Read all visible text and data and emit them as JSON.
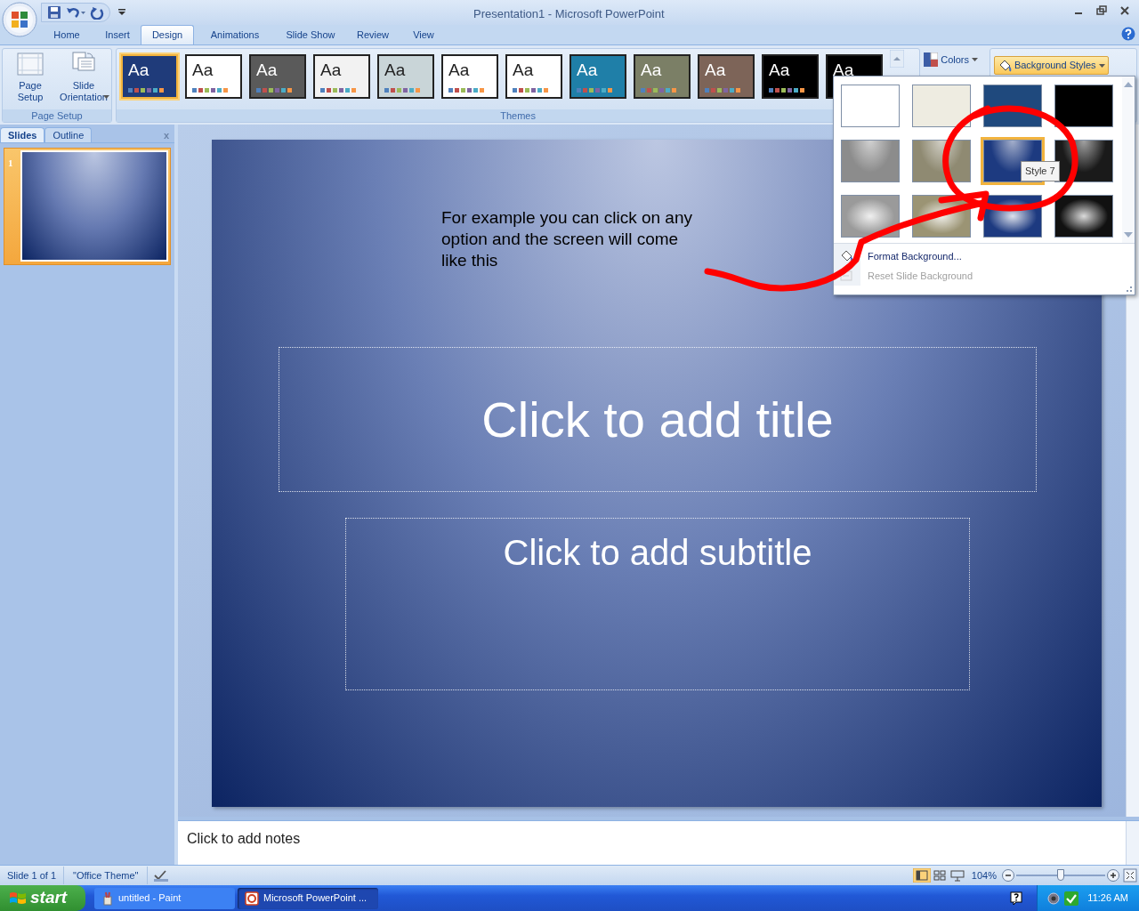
{
  "window": {
    "title": "Presentation1 - Microsoft PowerPoint"
  },
  "ribbon_tabs": [
    {
      "label": "Home",
      "selected": false
    },
    {
      "label": "Insert",
      "selected": false
    },
    {
      "label": "Design",
      "selected": true
    },
    {
      "label": "Animations",
      "selected": false
    },
    {
      "label": "Slide Show",
      "selected": false
    },
    {
      "label": "Review",
      "selected": false
    },
    {
      "label": "View",
      "selected": false
    }
  ],
  "page_setup_group": {
    "label": "Page Setup",
    "buttons": [
      {
        "label": "Page Setup",
        "kind": "setup"
      },
      {
        "label": "Slide Orientation",
        "kind": "orientation"
      }
    ]
  },
  "themes_group": {
    "label": "Themes",
    "themes": [
      {
        "label": "Aa",
        "color": "#1f3b7a",
        "selected": true
      },
      {
        "label": "Aa",
        "color": "#ffffff",
        "selected": false
      },
      {
        "label": "Aa",
        "color": "#5a5a5a",
        "selected": false
      },
      {
        "label": "Aa",
        "color": "#f2f2f2",
        "selected": false
      },
      {
        "label": "Aa",
        "color": "#c9d5d8",
        "selected": false
      },
      {
        "label": "Aa",
        "color": "#ffffff",
        "selected": false
      },
      {
        "label": "Aa",
        "color": "#ffffff",
        "selected": false
      },
      {
        "label": "Aa",
        "color": "#1f7fa8",
        "selected": false
      },
      {
        "label": "Aa",
        "color": "#7b7f66",
        "selected": false
      },
      {
        "label": "Aa",
        "color": "#7d6458",
        "selected": false
      },
      {
        "label": "Aa",
        "color": "#000000",
        "selected": false
      },
      {
        "label": "Aa",
        "color": "#000000",
        "selected": false
      }
    ]
  },
  "colors_button": {
    "label": "Colors"
  },
  "background_styles_button": {
    "label": "Background Styles"
  },
  "background_styles_menu": {
    "styles": [
      {
        "kind": "solid",
        "color": "#ffffff",
        "selected": false
      },
      {
        "kind": "solid",
        "color": "#eeece1",
        "selected": false
      },
      {
        "kind": "solid",
        "color": "#1f497d",
        "selected": false
      },
      {
        "kind": "solid",
        "color": "#000000",
        "selected": false
      },
      {
        "kind": "linear",
        "color": "#8c8c8c",
        "selected": false
      },
      {
        "kind": "linear",
        "color": "#8f8a72",
        "selected": false
      },
      {
        "kind": "linear",
        "color": "#1d3a80",
        "selected": true
      },
      {
        "kind": "linear",
        "color": "#1a1a1a",
        "selected": false
      },
      {
        "kind": "radial",
        "color": "#9a9a9a",
        "selected": false
      },
      {
        "kind": "radial",
        "color": "#9b9474",
        "selected": false
      },
      {
        "kind": "radial",
        "color": "#1d3a80",
        "selected": false
      },
      {
        "kind": "radial",
        "color": "#111111",
        "selected": false
      }
    ],
    "tooltip": "Style 7",
    "items": [
      {
        "label": "Format Background...",
        "kind": "format",
        "disabled": false
      },
      {
        "label": "Reset Slide Background",
        "kind": "reset",
        "disabled": true
      }
    ]
  },
  "slides_pane": {
    "tabs": [
      {
        "label": "Slides",
        "selected": true
      },
      {
        "label": "Outline",
        "selected": false
      }
    ],
    "close": "x",
    "slides": [
      {
        "number": "1",
        "selected": true
      }
    ]
  },
  "slide": {
    "note": "For example you can click on any option and the screen will come like this",
    "title_placeholder": "Click to add title",
    "subtitle_placeholder": "Click to add subtitle"
  },
  "notes": {
    "placeholder": "Click to add notes"
  },
  "status_bar": {
    "slide_info": "Slide 1 of 1",
    "theme": "\"Office Theme\"",
    "views": [
      {
        "kind": "normal",
        "selected": true
      },
      {
        "kind": "sorter",
        "selected": false
      },
      {
        "kind": "show",
        "selected": false
      }
    ],
    "zoom": "104%",
    "zoom_slider": {
      "level": 0.5
    }
  },
  "taskbar": {
    "start": "start",
    "tasks": [
      {
        "label": "untitled - Paint",
        "kind": "paint",
        "selected": false
      },
      {
        "label": "Microsoft PowerPoint ...",
        "kind": "powerpoint",
        "selected": true
      }
    ],
    "clock": "11:26 AM"
  }
}
